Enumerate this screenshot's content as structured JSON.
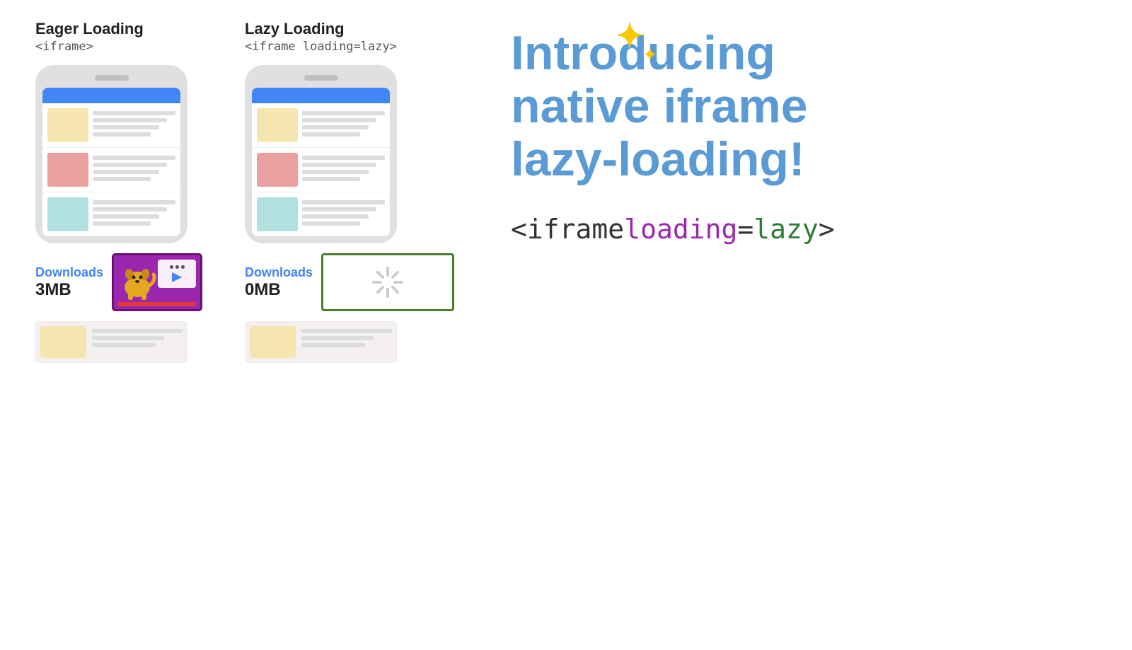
{
  "eager": {
    "title": "Eager Loading",
    "subtitle": "<iframe>",
    "downloads_label": "Downloads",
    "downloads_size": "3MB"
  },
  "lazy": {
    "title": "Lazy Loading",
    "subtitle": "<iframe loading=lazy>",
    "downloads_label": "Downloads",
    "downloads_size": "0MB"
  },
  "intro": {
    "line1": "Introducing",
    "line2": "native iframe",
    "line3": "lazy-loading!",
    "code_prefix": "<iframe ",
    "code_loading": "loading",
    "code_equals": "=",
    "code_lazy": "lazy",
    "code_suffix": ">"
  }
}
